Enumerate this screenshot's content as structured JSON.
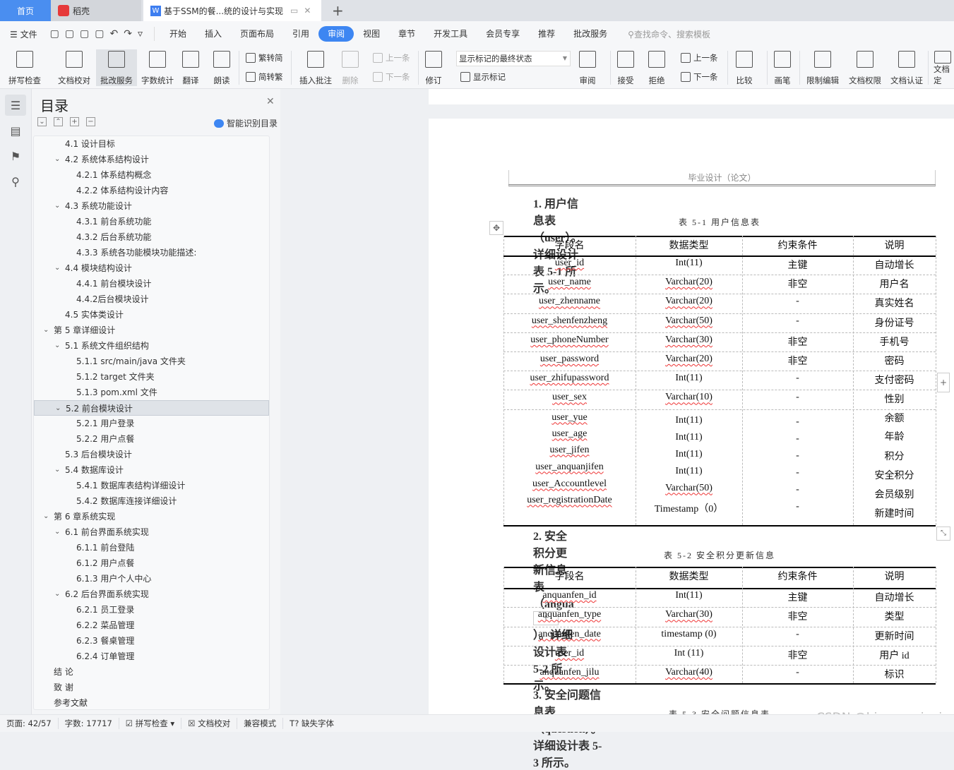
{
  "tabs": [
    {
      "label": "首页"
    },
    {
      "label": "稻壳"
    },
    {
      "label": "基于SSM的餐...统的设计与实现"
    }
  ],
  "colors": {
    "accent": "#3d86f2",
    "home_tab": "#4a8ef0",
    "daoke": "#e6393a"
  },
  "menu": {
    "file": "文件",
    "items": [
      "开始",
      "插入",
      "页面布局",
      "引用",
      "审阅",
      "视图",
      "章节",
      "开发工具",
      "会员专享",
      "推荐",
      "批改服务"
    ],
    "active": "审阅",
    "search_placeholder": "查找命令、搜索模板"
  },
  "ribbon": {
    "spell": "拼写检查",
    "proof": "文档校对",
    "correct": "批改服务",
    "wordcount": "字数统计",
    "translate": "翻译",
    "read": "朗读",
    "t2s": "繁转简",
    "s2t": "简转繁",
    "insert_comment": "插入批注",
    "delete": "删除",
    "prev": "上一条",
    "next": "下一条",
    "revise": "修订",
    "markup_state": "显示标记的最终状态",
    "show_markup": "显示标记",
    "review": "审阅",
    "accept": "接受",
    "reject": "拒绝",
    "prev2": "上一条",
    "next2": "下一条",
    "compare": "比较",
    "pen": "画笔",
    "restrict": "限制编辑",
    "permission": "文档权限",
    "certify": "文档认证",
    "more": "文档定"
  },
  "toc": {
    "title": "目录",
    "smart": "智能识别目录",
    "items": [
      {
        "label": "4.1  设计目标",
        "level": 2,
        "chev": false
      },
      {
        "label": "4.2  系统体系结构设计",
        "level": 2,
        "chev": true
      },
      {
        "label": "4.2.1  体系结构概念",
        "level": 3,
        "chev": false
      },
      {
        "label": "4.2.2  体系结构设计内容",
        "level": 3,
        "chev": false
      },
      {
        "label": "4.3  系统功能设计",
        "level": 2,
        "chev": true
      },
      {
        "label": "4.3.1  前台系统功能",
        "level": 3,
        "chev": false
      },
      {
        "label": "4.3.2  后台系统功能",
        "level": 3,
        "chev": false
      },
      {
        "label": "4.3.3  系统各功能模块功能描述:",
        "level": 3,
        "chev": false
      },
      {
        "label": "4.4  模块结构设计",
        "level": 2,
        "chev": true
      },
      {
        "label": "4.4.1  前台模块设计",
        "level": 3,
        "chev": false
      },
      {
        "label": "4.4.2后台模块设计",
        "level": 3,
        "chev": false
      },
      {
        "label": "4.5  实体类设计",
        "level": 2,
        "chev": false
      },
      {
        "label": "第 5 章详细设计",
        "level": 1,
        "chev": true
      },
      {
        "label": "5.1  系统文件组织结构",
        "level": 2,
        "chev": true
      },
      {
        "label": "5.1.1 src/main/java 文件夹",
        "level": 3,
        "chev": false
      },
      {
        "label": "5.1.2 target 文件夹",
        "level": 3,
        "chev": false
      },
      {
        "label": "5.1.3 pom.xml 文件",
        "level": 3,
        "chev": false
      },
      {
        "label": "5.2  前台模块设计",
        "level": 2,
        "chev": true,
        "selected": true
      },
      {
        "label": "5.2.1  用户登录",
        "level": 3,
        "chev": false
      },
      {
        "label": "5.2.2  用户点餐",
        "level": 3,
        "chev": false
      },
      {
        "label": "5.3  后台模块设计",
        "level": 2,
        "chev": false
      },
      {
        "label": "5.4  数据库设计",
        "level": 2,
        "chev": true
      },
      {
        "label": "5.4.1  数据库表结构详细设计",
        "level": 3,
        "chev": false
      },
      {
        "label": "5.4.2  数据库连接详细设计",
        "level": 3,
        "chev": false
      },
      {
        "label": "第 6 章系统实现",
        "level": 1,
        "chev": true
      },
      {
        "label": "6.1  前台界面系统实现",
        "level": 2,
        "chev": true
      },
      {
        "label": "6.1.1  前台登陆",
        "level": 3,
        "chev": false
      },
      {
        "label": "6.1.2  用户点餐",
        "level": 3,
        "chev": false
      },
      {
        "label": "6.1.3  用户个人中心",
        "level": 3,
        "chev": false
      },
      {
        "label": "6.2  后台界面系统实现",
        "level": 2,
        "chev": true
      },
      {
        "label": "6.2.1  员工登录",
        "level": 3,
        "chev": false
      },
      {
        "label": "6.2.2  菜品管理",
        "level": 3,
        "chev": false
      },
      {
        "label": "6.2.3  餐桌管理",
        "level": 3,
        "chev": false
      },
      {
        "label": "6.2.4  订单管理",
        "level": 3,
        "chev": false
      },
      {
        "label": "结    论",
        "level": 1,
        "chev": false
      },
      {
        "label": "致    谢",
        "level": 1,
        "chev": false
      },
      {
        "label": "参考文献",
        "level": 1,
        "chev": false
      }
    ]
  },
  "doc": {
    "header": "毕业设计（论文）",
    "h1": "1. 用户信息表（user）。详细设计表 5-1 所示。",
    "cap1": "表 5-1 用户信息表",
    "cols": [
      "字段名",
      "数据类型",
      "约束条件",
      "说明"
    ],
    "t1": [
      [
        "user_id",
        "Int(11)",
        "主键",
        "自动增长"
      ],
      [
        "user_name",
        "Varchar(20)",
        "非空",
        "用户名"
      ],
      [
        "user_zhenname",
        "Varchar(20)",
        "-",
        "真实姓名"
      ],
      [
        "user_shenfenzheng",
        "Varchar(50)",
        "-",
        "身份证号"
      ],
      [
        "user_phoneNumber",
        "Varchar(30)",
        "非空",
        "手机号"
      ],
      [
        "user_password",
        "Varchar(20)",
        "非空",
        "密码"
      ],
      [
        "user_zhifupassword",
        "Int(11)",
        "-",
        "支付密码"
      ],
      [
        "user_sex",
        "Varchar(10)",
        "-",
        "性别"
      ]
    ],
    "t1b": {
      "c0": [
        "user_yue",
        "user_age",
        "user_jifen",
        "user_anquanjifen",
        "user_Accountlevel",
        "user_registrationDate"
      ],
      "c1": [
        "Int(11)",
        "Int(11)",
        "Int(11)",
        "Int(11)",
        "Varchar(50)",
        "Timestamp（0）"
      ],
      "c2": [
        "-",
        "-",
        "-",
        "-",
        "-",
        "-"
      ],
      "c3": [
        "余额",
        "年龄",
        "积分",
        "安全积分",
        "会员级别",
        "新建时间"
      ]
    },
    "h2": "2. 安全积分更新信息表（angua",
    "h2b": "）。详细设计表 5-2 所示。",
    "cap2": "表 5-2  安全积分更新信息",
    "t2": [
      [
        "anquanfen_id",
        "Int(11)",
        "主键",
        "自动增长"
      ],
      [
        "anquanfen_type",
        "Varchar(30)",
        "非空",
        "类型"
      ],
      [
        "anquanfen_date",
        "timestamp (0)",
        "-",
        "更新时间"
      ],
      [
        "user_id",
        "Int (11)",
        "非空",
        "用户 id"
      ],
      [
        "anquanfen_jilu",
        "Varchar(40)",
        "-",
        "标识"
      ]
    ],
    "h3": "3. 安全问题信息表（question）。详细设计表 5-3 所示。",
    "cap3": "表 5-3  安全问题信息表"
  },
  "status": {
    "page": "页面: 42/57",
    "words": "字数: 17717",
    "spell": "拼写检查",
    "proof": "文档校对",
    "compat": "兼容模式",
    "missing_font": "缺失字体"
  },
  "watermark": "CSDN @biyezuopinvip"
}
